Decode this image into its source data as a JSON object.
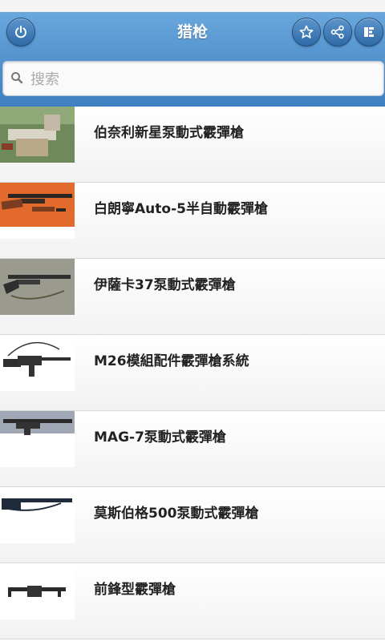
{
  "header": {
    "title": "猎枪",
    "buttons": [
      "power-icon",
      "star-icon",
      "share-icon",
      "menu-icon"
    ]
  },
  "search": {
    "placeholder": "搜索",
    "value": ""
  },
  "items": [
    {
      "label": "伯奈利新星泵動式霰彈槍",
      "icon": "shotgun-photo"
    },
    {
      "label": "白朗寧Auto-5半自動霰彈槍",
      "icon": "shotgun-photo"
    },
    {
      "label": "伊薩卡37泵動式霰彈槍",
      "icon": "shotgun-photo"
    },
    {
      "label": "M26模組配件霰彈槍系統",
      "icon": "shotgun-photo"
    },
    {
      "label": "MAG-7泵動式霰彈槍",
      "icon": "shotgun-photo"
    },
    {
      "label": "莫斯伯格500泵動式霰彈槍",
      "icon": "shotgun-photo"
    },
    {
      "label": "前鋒型霰彈槍",
      "icon": "shotgun-photo"
    }
  ],
  "colors": {
    "header": "#4a8bcb",
    "background": "#ffffff"
  }
}
